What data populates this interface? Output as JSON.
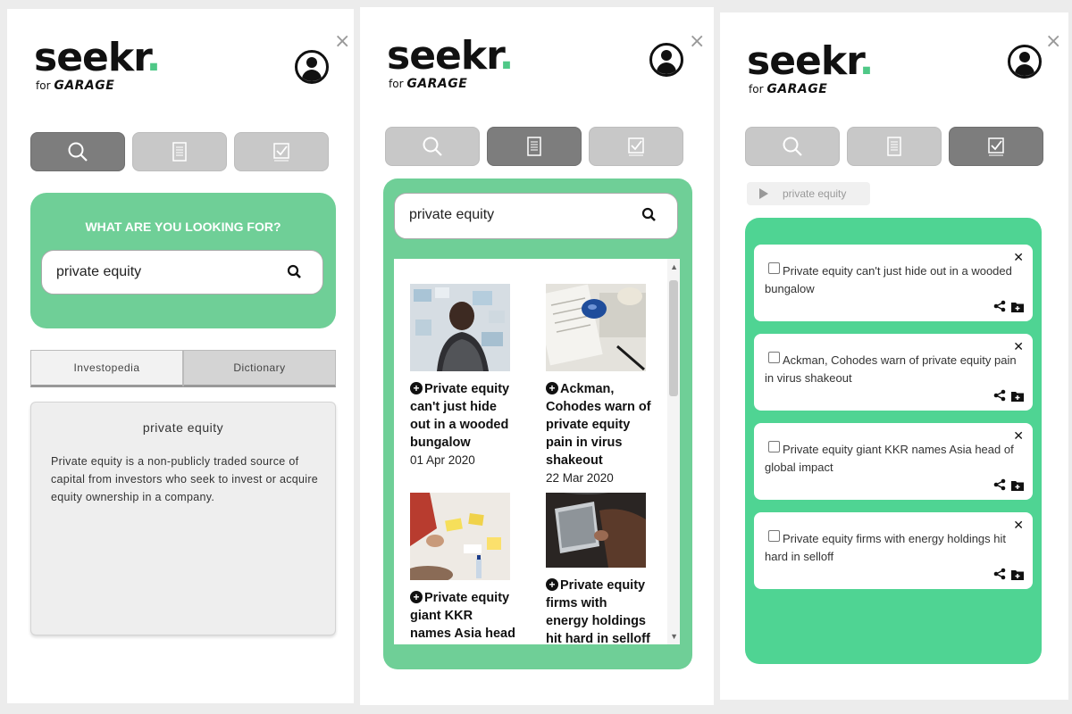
{
  "brand": {
    "word": "seekr",
    "dot": ".",
    "sub_prefix": "for",
    "sub_name": "GARAGE"
  },
  "close_symbol": "×",
  "colors": {
    "accent": "#6fcf97",
    "accent_saved": "#4fd493",
    "tab_active": "#7d7d7d",
    "tab_inactive": "#c8c8c8"
  },
  "tabs": [
    {
      "icon": "search-icon"
    },
    {
      "icon": "document-icon"
    },
    {
      "icon": "checklist-icon"
    }
  ],
  "search_panel": {
    "heading": "WHAT ARE YOU LOOKING FOR?",
    "query": "private equity",
    "source_tabs": [
      "Investopedia",
      "Dictionary"
    ],
    "definition_title": "private equity",
    "definition_text": "Private equity is a non-publicly traded source of capital from investors who seek to invest or acquire equity ownership in a company."
  },
  "results_panel": {
    "query": "private equity",
    "results": [
      {
        "title": "Private equity can't just hide out in a wooded bungalow",
        "date": "01 Apr 2020",
        "image": "man-at-wall-image"
      },
      {
        "title": "Ackman, Cohodes warn of private equity pain in virus shakeout",
        "date": "22 Mar 2020",
        "image": "desk-mouse-image"
      },
      {
        "title": "Private equity giant KKR names Asia head of global",
        "date": "",
        "image": "meeting-table-image"
      },
      {
        "title": "Private equity firms with energy holdings hit hard in selloff",
        "date": "",
        "image": "laptop-hands-image"
      }
    ]
  },
  "saved_panel": {
    "breadcrumb": "private equity",
    "items": [
      {
        "title": "Private equity can't just hide out in a wooded bungalow"
      },
      {
        "title": "Ackman, Cohodes warn of private equity pain in virus shakeout"
      },
      {
        "title": "Private equity giant KKR names Asia head of global impact"
      },
      {
        "title": "Private equity firms with energy holdings hit hard in selloff"
      }
    ]
  }
}
